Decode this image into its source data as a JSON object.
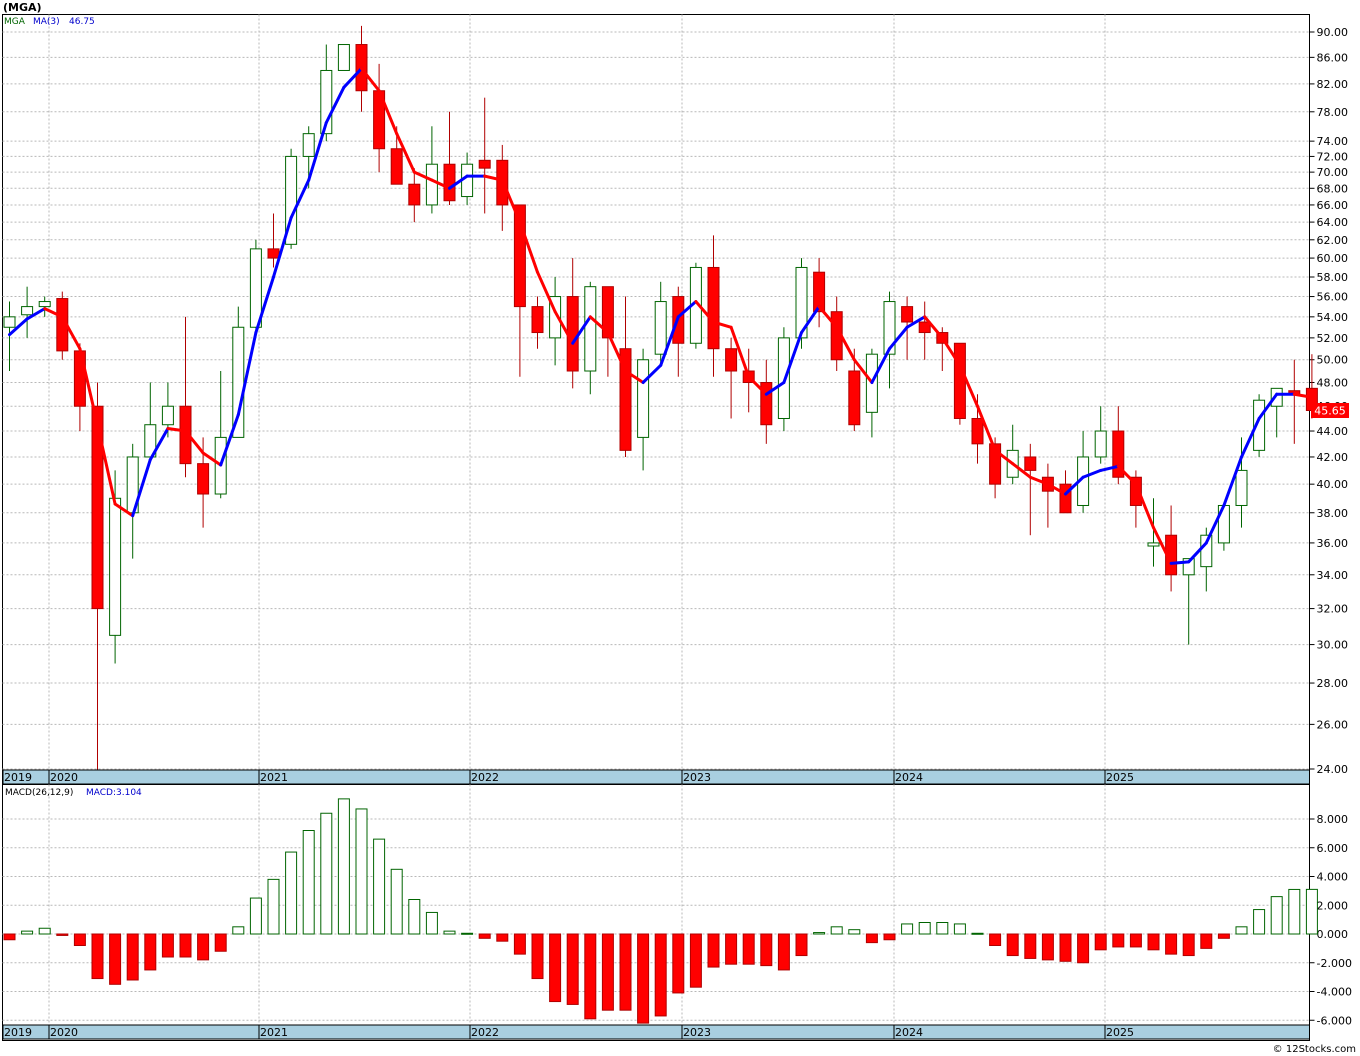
{
  "header": {
    "title": "(MGA)"
  },
  "price_legend": {
    "symbol": "MGA",
    "ma_label": "MA(3)",
    "ma_value": "46.75"
  },
  "macd_legend": {
    "label": "MACD(26,12,9)",
    "value_label": "MACD:3.104"
  },
  "last_price_label": "45.65",
  "credit": "© 12Stocks.com",
  "colors": {
    "up_candle": "#006400",
    "down_candle": "#ff0000",
    "ma_up": "#0000ff",
    "ma_down": "#ff0000",
    "axis_strip": "#a9cfe0",
    "grid": "#b8b8b8",
    "price_label_bg": "#ff0000"
  },
  "chart_data": [
    {
      "type": "candlestick",
      "interval": "monthly",
      "y_scale": "log",
      "ylim": [
        22.6,
        92
      ],
      "y_ticks": [
        "24.00",
        "26.00",
        "28.00",
        "30.00",
        "32.00",
        "34.00",
        "36.00",
        "38.00",
        "40.00",
        "42.00",
        "44.00",
        "46.00",
        "48.00",
        "50.00",
        "52.00",
        "54.00",
        "56.00",
        "58.00",
        "60.00",
        "62.00",
        "64.00",
        "66.00",
        "68.00",
        "70.00",
        "72.00",
        "74.00",
        "78.00",
        "82.00",
        "86.00",
        "90.00"
      ],
      "x_labels": [
        "2019",
        "2020",
        "2021",
        "2022",
        "2023",
        "2024",
        "2025"
      ],
      "grid": true,
      "ohlc": [
        [
          53.0,
          55.5,
          49.0,
          54.0
        ],
        [
          54.2,
          57.0,
          52.0,
          55.0
        ],
        [
          55.0,
          56.0,
          54.0,
          55.5
        ],
        [
          55.8,
          56.5,
          50.0,
          50.8
        ],
        [
          50.8,
          51.5,
          44.0,
          46.0
        ],
        [
          46.0,
          48.0,
          22.6,
          32.0
        ],
        [
          30.5,
          41.0,
          29.0,
          39.0
        ],
        [
          38.0,
          43.0,
          35.0,
          42.0
        ],
        [
          42.0,
          48.0,
          42.0,
          44.5
        ],
        [
          44.5,
          48.0,
          43.5,
          46.0
        ],
        [
          46.0,
          54.0,
          40.5,
          41.5
        ],
        [
          41.5,
          43.5,
          37.0,
          39.3
        ],
        [
          39.3,
          49.0,
          39.0,
          43.5
        ],
        [
          43.5,
          55.0,
          43.5,
          53.0
        ],
        [
          53.0,
          62.0,
          52.0,
          61.0
        ],
        [
          61.0,
          65.0,
          59.0,
          60.0
        ],
        [
          61.5,
          73.0,
          61.0,
          72.0
        ],
        [
          72.0,
          76.0,
          68.0,
          75.0
        ],
        [
          75.0,
          88.0,
          74.0,
          84.0
        ],
        [
          84.0,
          88.0,
          84.0,
          88.0
        ],
        [
          88.0,
          91.0,
          78.0,
          81.0
        ],
        [
          81.0,
          85.0,
          70.0,
          73.0
        ],
        [
          73.0,
          76.0,
          69.0,
          68.5
        ],
        [
          68.5,
          70.5,
          64.0,
          66.0
        ],
        [
          66.0,
          76.0,
          65.0,
          71.0
        ],
        [
          71.0,
          78.0,
          66.0,
          66.5
        ],
        [
          67.0,
          72.5,
          66.0,
          71.0
        ],
        [
          71.5,
          80.0,
          65.0,
          70.5
        ],
        [
          71.5,
          73.5,
          63.0,
          66.0
        ],
        [
          66.0,
          66.0,
          48.5,
          55.0
        ],
        [
          55.0,
          56.0,
          51.0,
          52.5
        ],
        [
          52.0,
          58.0,
          49.5,
          56.0
        ],
        [
          56.0,
          60.0,
          47.5,
          49.0
        ],
        [
          49.0,
          57.5,
          47.0,
          57.0
        ],
        [
          57.0,
          57.0,
          48.5,
          52.0
        ],
        [
          51.0,
          56.0,
          42.0,
          42.5
        ],
        [
          43.5,
          51.0,
          41.0,
          50.0
        ],
        [
          50.5,
          57.5,
          49.5,
          55.5
        ],
        [
          56.0,
          57.0,
          48.5,
          51.5
        ],
        [
          51.5,
          59.5,
          51.0,
          59.0
        ],
        [
          59.0,
          62.5,
          48.5,
          51.0
        ],
        [
          51.0,
          52.0,
          45.0,
          49.0
        ],
        [
          49.0,
          51.0,
          45.5,
          48.0
        ],
        [
          48.0,
          50.0,
          43.0,
          44.5
        ],
        [
          45.0,
          53.0,
          44.0,
          52.0
        ],
        [
          52.0,
          60.0,
          51.0,
          59.0
        ],
        [
          58.5,
          60.0,
          53.0,
          54.5
        ],
        [
          54.5,
          56.0,
          49.0,
          50.0
        ],
        [
          49.0,
          51.0,
          44.0,
          44.5
        ],
        [
          45.5,
          51.0,
          43.5,
          50.5
        ],
        [
          50.5,
          56.5,
          47.5,
          55.5
        ],
        [
          55.0,
          56.0,
          50.0,
          53.5
        ],
        [
          53.5,
          55.5,
          50.0,
          52.5
        ],
        [
          52.5,
          53.0,
          49.0,
          51.5
        ],
        [
          51.5,
          51.5,
          44.5,
          45.0
        ],
        [
          45.0,
          47.0,
          41.5,
          43.0
        ],
        [
          43.0,
          43.5,
          39.0,
          40.0
        ],
        [
          40.5,
          44.5,
          40.0,
          42.5
        ],
        [
          42.0,
          43.0,
          36.5,
          41.0
        ],
        [
          40.5,
          41.5,
          37.0,
          39.5
        ],
        [
          40.0,
          41.0,
          38.0,
          38.0
        ],
        [
          38.5,
          44.0,
          38.0,
          42.0
        ],
        [
          42.0,
          46.0,
          41.5,
          44.0
        ],
        [
          44.0,
          46.0,
          40.0,
          40.5
        ],
        [
          40.5,
          41.0,
          37.0,
          38.5
        ],
        [
          35.8,
          39.0,
          34.5,
          36.0
        ],
        [
          36.5,
          38.5,
          33.0,
          34.0
        ],
        [
          34.0,
          35.0,
          30.0,
          35.0
        ],
        [
          34.5,
          37.0,
          33.0,
          36.5
        ],
        [
          36.0,
          38.5,
          35.5,
          38.5
        ],
        [
          38.5,
          43.5,
          37.0,
          41.0
        ],
        [
          42.5,
          47.0,
          42.0,
          46.5
        ],
        [
          46.0,
          47.5,
          43.5,
          47.5
        ],
        [
          47.3,
          50.0,
          43.0,
          47.0
        ],
        [
          47.5,
          50.5,
          45.0,
          45.65
        ]
      ],
      "ma3": [
        52.3,
        53.8,
        54.8,
        54.0,
        51.0,
        44.5,
        38.6,
        37.8,
        41.8,
        44.2,
        44.0,
        42.3,
        41.4,
        45.3,
        52.5,
        58.0,
        64.5,
        69.0,
        76.5,
        81.5,
        84.3,
        81.0,
        75.0,
        70.0,
        69.0,
        68.0,
        69.5,
        69.5,
        69.0,
        64.0,
        58.5,
        54.5,
        51.5,
        54.0,
        52.5,
        49.0,
        48.0,
        49.5,
        54.0,
        55.5,
        53.5,
        53.0,
        48.5,
        47.0,
        48.0,
        52.5,
        55.0,
        53.0,
        50.0,
        48.0,
        51.0,
        53.0,
        54.0,
        52.0,
        49.5,
        46.0,
        42.5,
        41.5,
        40.5,
        40.0,
        39.3,
        40.5,
        41.0,
        41.3,
        40.0,
        37.0,
        34.7,
        34.8,
        36.0,
        38.5,
        42.0,
        45.0,
        47.0,
        47.0,
        46.75
      ]
    },
    {
      "type": "bar",
      "name": "MACD(26,12,9)",
      "ylim": [
        -6.3,
        9.7
      ],
      "y_ticks": [
        "-6.000",
        "-4.000",
        "-2.000",
        "0.000",
        "2.000",
        "4.000",
        "6.000",
        "8.000"
      ],
      "x_labels": [
        "2019",
        "2020",
        "2021",
        "2022",
        "2023",
        "2024",
        "2025"
      ],
      "values": [
        -0.4,
        0.2,
        0.4,
        -0.1,
        -0.8,
        -3.1,
        -3.5,
        -3.2,
        -2.5,
        -1.6,
        -1.6,
        -1.8,
        -1.2,
        0.5,
        2.5,
        3.8,
        5.7,
        7.2,
        8.4,
        9.4,
        8.7,
        6.6,
        4.5,
        2.4,
        1.5,
        0.2,
        0.05,
        -0.3,
        -0.5,
        -1.4,
        -3.1,
        -4.7,
        -4.9,
        -5.9,
        -5.3,
        -5.3,
        -6.2,
        -5.7,
        -4.1,
        -3.7,
        -2.3,
        -2.1,
        -2.1,
        -2.2,
        -2.5,
        -1.5,
        0.1,
        0.5,
        0.3,
        -0.6,
        -0.4,
        0.7,
        0.8,
        0.8,
        0.7,
        0.05,
        -0.8,
        -1.5,
        -1.7,
        -1.8,
        -1.9,
        -2.0,
        -1.1,
        -0.9,
        -0.9,
        -1.1,
        -1.4,
        -1.5,
        -1.0,
        -0.3,
        0.5,
        1.7,
        2.6,
        3.1,
        3.104
      ]
    }
  ]
}
